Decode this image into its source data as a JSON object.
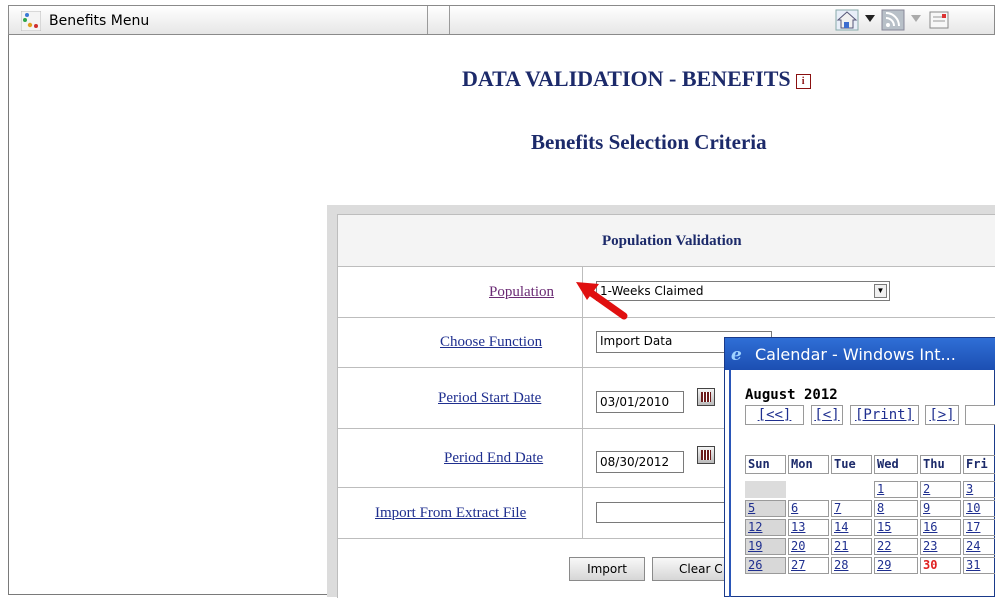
{
  "tab": {
    "title": "Benefits Menu"
  },
  "page": {
    "title": "DATA VALIDATION - BENEFITS",
    "info_icon_text": "i",
    "subtitle": "Benefits Selection Criteria"
  },
  "form": {
    "header": "Population Validation",
    "population_label": "Population",
    "population_value": "1-Weeks Claimed",
    "function_label": "Choose Function",
    "function_value": "Import Data",
    "start_label": "Period Start Date",
    "start_value": "03/01/2010",
    "end_label": "Period End Date",
    "end_value": "08/30/2012",
    "import_label": "Import From Extract File",
    "import_button": "Import",
    "clear_button": "Clear C"
  },
  "calendar": {
    "window_title": "Calendar - Windows Int...",
    "ie_icon": "e",
    "month": "August 2012",
    "nav": [
      "[<<]",
      "[<]",
      "[Print]",
      "[>]"
    ],
    "days": [
      "Sun",
      "Mon",
      "Tue",
      "Wed",
      "Thu",
      "Fri"
    ],
    "weeks": [
      [
        "",
        "",
        "",
        "1",
        "2",
        "3"
      ],
      [
        "5",
        "6",
        "7",
        "8",
        "9",
        "10"
      ],
      [
        "12",
        "13",
        "14",
        "15",
        "16",
        "17"
      ],
      [
        "19",
        "20",
        "21",
        "22",
        "23",
        "24"
      ],
      [
        "26",
        "27",
        "28",
        "29",
        "30",
        "31"
      ]
    ],
    "today": "30"
  },
  "colors": {
    "title": "#1c2a6a",
    "link": "#1f2f8f",
    "visited": "#6a2a74",
    "titlebar": "#2f6fd6",
    "today": "#e02020"
  },
  "icons": [
    "benefits-app-icon",
    "home-icon",
    "feeds-icon",
    "mail-icon",
    "info-icon",
    "calendar-picker-icon",
    "red-arrow-icon",
    "ie-icon"
  ]
}
